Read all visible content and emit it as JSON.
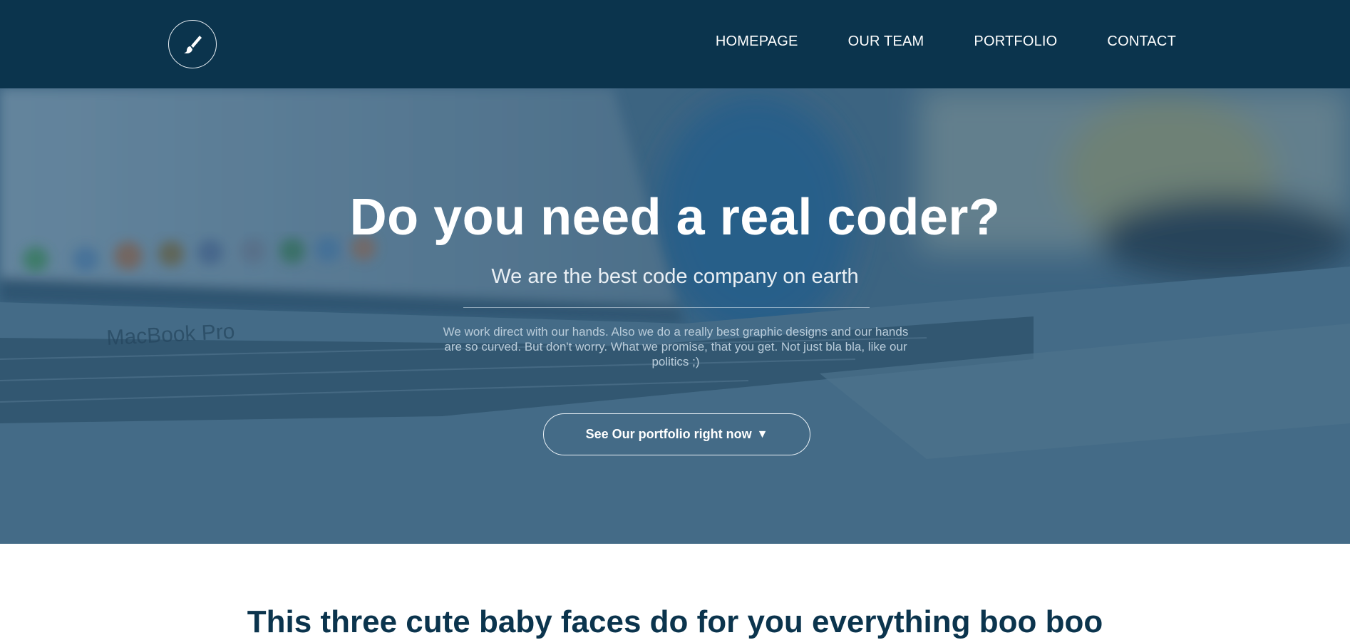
{
  "nav": {
    "logo_icon": "paintbrush-icon",
    "items": [
      {
        "label": "HOMEPAGE"
      },
      {
        "label": "OUR TEAM"
      },
      {
        "label": "PORTFOLIO"
      },
      {
        "label": "CONTACT"
      }
    ]
  },
  "hero": {
    "title": "Do you need a real coder?",
    "subtitle": "We are the best code company on earth",
    "description": "We work direct with our hands. Also we do a really best graphic designs and our hands are so curved. But don't worry. What we promise, that you get. Not just bla bla, like our politics ;)",
    "button_label": "See Our portfolio right now",
    "button_arrow": "▼"
  },
  "section": {
    "title": "This three cute baby faces do for you everything boo boo"
  },
  "colors": {
    "navbar": "#0b344d",
    "hero_tint": "#4e7a97",
    "heading": "#0b344d"
  }
}
